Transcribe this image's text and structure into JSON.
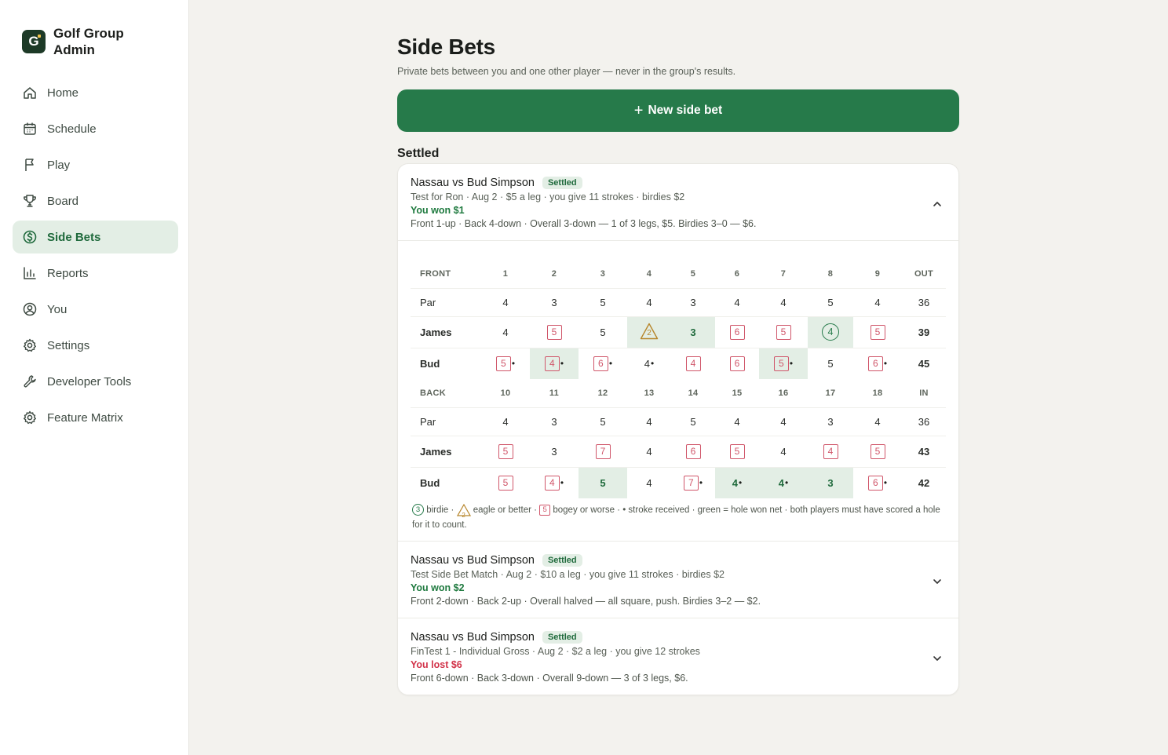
{
  "app": {
    "brand_letter": "G",
    "brand_name": "Golf Group Admin"
  },
  "sidebar": {
    "items": [
      {
        "label": "Home",
        "icon": "home-icon"
      },
      {
        "label": "Schedule",
        "icon": "calendar-icon"
      },
      {
        "label": "Play",
        "icon": "flag-icon"
      },
      {
        "label": "Board",
        "icon": "trophy-icon"
      },
      {
        "label": "Side Bets",
        "icon": "dollar-icon",
        "active": true
      },
      {
        "label": "Reports",
        "icon": "bar-chart-icon"
      },
      {
        "label": "You",
        "icon": "user-icon"
      },
      {
        "label": "Settings",
        "icon": "gear-icon"
      },
      {
        "label": "Developer Tools",
        "icon": "wrench-icon"
      },
      {
        "label": "Feature Matrix",
        "icon": "gear-icon"
      }
    ]
  },
  "page": {
    "title": "Side Bets",
    "subtitle": "Private bets between you and one other player — never in the group's results.",
    "new_bet_label": "New side bet",
    "section_title": "Settled"
  },
  "bets": [
    {
      "title": "Nassau vs Bud Simpson",
      "badge": "Settled",
      "meta": "Test for Ron · Aug 2 · $5 a leg · you give 11 strokes · birdies $2",
      "result": "You won $1",
      "summary": "Front 1-up · Back 4-down · Overall 3-down — 1 of 3 legs, $5. Birdies 3–0 — $6."
    },
    {
      "title": "Nassau vs Bud Simpson",
      "badge": "Settled",
      "meta": "Test Side Bet Match · Aug 2 · $10 a leg · you give 11 strokes · birdies $2",
      "result": "You won $2",
      "summary": "Front 2-down · Back 2-up · Overall halved — all square, push. Birdies 3–2 — $2."
    },
    {
      "title": "Nassau vs Bud Simpson",
      "badge": "Settled",
      "meta": "FinTest 1 - Individual Gross · Aug 2 · $2 a leg · you give 12 strokes",
      "result": "You lost $6",
      "summary": "Front 6-down · Back 3-down · Overall 9-down — 3 of 3 legs, $6."
    }
  ],
  "scorecard": {
    "front": {
      "label": "FRONT",
      "holes": [
        "1",
        "2",
        "3",
        "4",
        "5",
        "6",
        "7",
        "8",
        "9"
      ],
      "total_label": "OUT",
      "par": {
        "label": "Par",
        "values": [
          "4",
          "3",
          "5",
          "4",
          "3",
          "4",
          "4",
          "5",
          "4"
        ],
        "total": "36"
      },
      "players": [
        {
          "name": "James",
          "total": "39",
          "cells": [
            {
              "v": "4"
            },
            {
              "v": "5",
              "t": "bogey"
            },
            {
              "v": "5"
            },
            {
              "v": "2",
              "t": "eagle",
              "win": true
            },
            {
              "v": "3",
              "t": "green",
              "win": true
            },
            {
              "v": "6",
              "t": "bogey"
            },
            {
              "v": "5",
              "t": "bogey"
            },
            {
              "v": "4",
              "t": "birdie",
              "win": true
            },
            {
              "v": "5",
              "t": "bogey"
            }
          ]
        },
        {
          "name": "Bud",
          "total": "45",
          "cells": [
            {
              "v": "5",
              "t": "bogey",
              "dot": true
            },
            {
              "v": "4",
              "t": "bogey",
              "dot": true,
              "win": true
            },
            {
              "v": "6",
              "t": "bogey",
              "dot": true
            },
            {
              "v": "4",
              "dot": true
            },
            {
              "v": "4",
              "t": "bogey"
            },
            {
              "v": "6",
              "t": "bogey"
            },
            {
              "v": "5",
              "t": "bogey",
              "dot": true,
              "win": true
            },
            {
              "v": "5"
            },
            {
              "v": "6",
              "t": "bogey",
              "dot": true
            }
          ]
        }
      ]
    },
    "back": {
      "label": "BACK",
      "holes": [
        "10",
        "11",
        "12",
        "13",
        "14",
        "15",
        "16",
        "17",
        "18"
      ],
      "total_label": "IN",
      "par": {
        "label": "Par",
        "values": [
          "4",
          "3",
          "5",
          "4",
          "5",
          "4",
          "4",
          "3",
          "4"
        ],
        "total": "36"
      },
      "players": [
        {
          "name": "James",
          "total": "43",
          "cells": [
            {
              "v": "5",
              "t": "bogey"
            },
            {
              "v": "3"
            },
            {
              "v": "7",
              "t": "bogey"
            },
            {
              "v": "4"
            },
            {
              "v": "6",
              "t": "bogey"
            },
            {
              "v": "5",
              "t": "bogey"
            },
            {
              "v": "4"
            },
            {
              "v": "4",
              "t": "bogey"
            },
            {
              "v": "5",
              "t": "bogey"
            }
          ]
        },
        {
          "name": "Bud",
          "total": "42",
          "cells": [
            {
              "v": "5",
              "t": "bogey"
            },
            {
              "v": "4",
              "t": "bogey",
              "dot": true
            },
            {
              "v": "5",
              "t": "green",
              "win": true
            },
            {
              "v": "4"
            },
            {
              "v": "7",
              "t": "bogey",
              "dot": true
            },
            {
              "v": "4",
              "t": "green",
              "dot": true,
              "win": true
            },
            {
              "v": "4",
              "t": "green",
              "dot": true,
              "win": true
            },
            {
              "v": "3",
              "t": "green",
              "win": true
            },
            {
              "v": "6",
              "t": "bogey",
              "dot": true
            }
          ]
        }
      ]
    },
    "legend": {
      "birdie_sample": "3",
      "birdie": "birdie ·",
      "eagle_sample": "2",
      "eagle": "eagle or better ·",
      "bogey_sample": "5",
      "rest": "bogey or worse · • stroke received · green = hole won net · both players must have scored a hole for it to count."
    }
  },
  "colors": {
    "accent": "#267a4a",
    "active_nav_bg": "#e3eee5",
    "bogey": "#d0566a",
    "eagle": "#b7862c",
    "lost": "#d2344a"
  }
}
